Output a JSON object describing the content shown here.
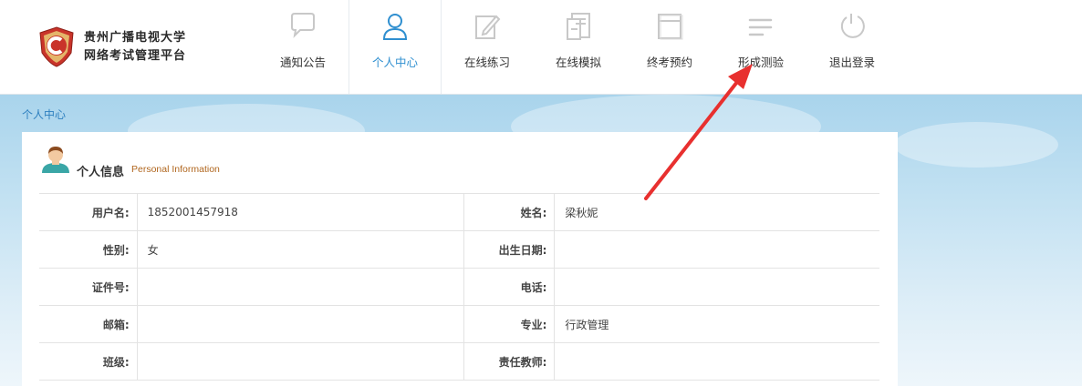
{
  "logo": {
    "line1": "贵州广播电视大学",
    "line2": "网络考试管理平台"
  },
  "nav": [
    {
      "label": "通知公告",
      "icon": "speech-bubble-icon"
    },
    {
      "label": "个人中心",
      "icon": "user-icon",
      "active": true
    },
    {
      "label": "在线练习",
      "icon": "pencil-edit-icon"
    },
    {
      "label": "在线模拟",
      "icon": "document-stack-icon"
    },
    {
      "label": "终考预约",
      "icon": "calendar-icon"
    },
    {
      "label": "形成测验",
      "icon": "list-lines-icon"
    },
    {
      "label": "退出登录",
      "icon": "logout-refresh-icon"
    }
  ],
  "breadcrumb": "个人中心",
  "panel": {
    "title_cn": "个人信息",
    "title_en": "Personal Information"
  },
  "info": {
    "rows": [
      {
        "l1": "用户名:",
        "v1": "1852001457918",
        "l2": "姓名:",
        "v2": "梁秋妮"
      },
      {
        "l1": "性别:",
        "v1": "女",
        "l2": "出生日期:",
        "v2": ""
      },
      {
        "l1": "证件号:",
        "v1": "",
        "l2": "电话:",
        "v2": ""
      },
      {
        "l1": "邮箱:",
        "v1": "",
        "l2": "专业:",
        "v2": "行政管理"
      },
      {
        "l1": "班级:",
        "v1": "",
        "l2": "责任教师:",
        "v2": ""
      }
    ]
  },
  "colors": {
    "accent": "#2f8fd0",
    "arrow": "#e8302f",
    "en_title": "#b0661e"
  }
}
